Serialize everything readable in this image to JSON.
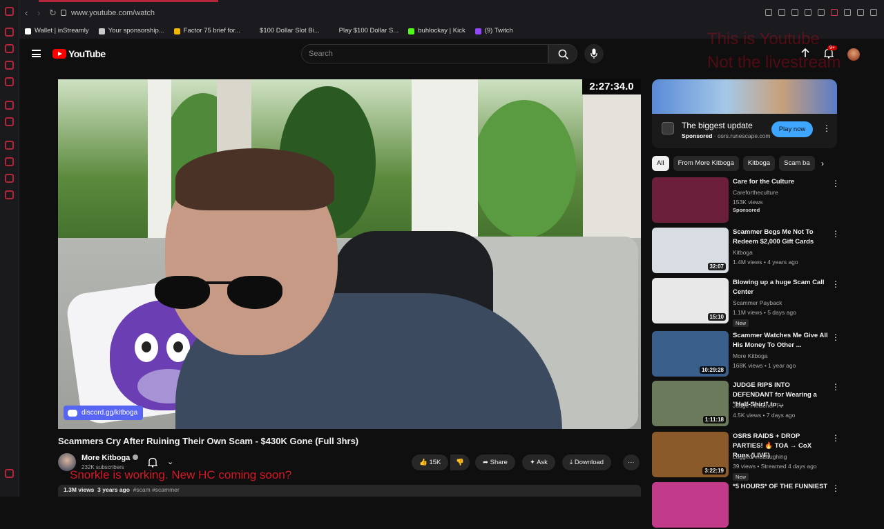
{
  "browser": {
    "url": "www.youtube.com/watch",
    "bookmarks": [
      {
        "label": "Wallet | inStreamly",
        "color": "#ffffff"
      },
      {
        "label": "Your sponsorship...",
        "color": "#cccccc"
      },
      {
        "label": "Factor 75 brief for...",
        "color": "#f4b400"
      },
      {
        "label": "$100 Dollar Slot Bi...",
        "color": "#1b1b1f"
      },
      {
        "label": "Play $100 Dollar S...",
        "color": "#1b1b1f"
      },
      {
        "label": "buhlockay | Kick",
        "color": "#53fc18"
      },
      {
        "label": "(9) Twitch",
        "color": "#9146ff"
      }
    ]
  },
  "header": {
    "logo_text": "YouTube",
    "search_placeholder": "Search",
    "notification_count": "9+",
    "overlay_note": [
      "This is Youtube",
      "Not the livestream"
    ]
  },
  "player": {
    "timer": "2:27:34.0",
    "discord": "discord.gg/kitboga"
  },
  "ad": {
    "title": "The biggest update",
    "sponsored": "Sponsored",
    "domain": "osrs.runescape.com",
    "cta": "Play now"
  },
  "chips": [
    "All",
    "From More Kitboga",
    "Kitboga",
    "Scam ba"
  ],
  "recommendations": [
    {
      "title": "Care for the Culture",
      "channel": "Carefortheculture",
      "stats": "153K views",
      "extra": "Sponsored",
      "duration": "",
      "new": "",
      "thumb": "#6b1f3a"
    },
    {
      "title": "Scammer Begs Me Not To Redeem $2,000 Gift Cards",
      "channel": "Kitboga",
      "stats": "1.4M views • 4 years ago",
      "extra": "",
      "duration": "32:07",
      "new": "",
      "thumb": "#d8dde4"
    },
    {
      "title": "Blowing up a huge Scam Call Center",
      "channel": "Scammer Payback",
      "stats": "1.1M views • 5 days ago",
      "extra": "",
      "duration": "15:10",
      "new": "New",
      "thumb": "#e8e8e8"
    },
    {
      "title": "Scammer Watches Me Give All His Money To Other ...",
      "channel": "More Kitboga",
      "stats": "168K views • 1 year ago",
      "extra": "",
      "duration": "10:29:28",
      "new": "",
      "thumb": "#3a5f8a"
    },
    {
      "title": "JUDGE RIPS INTO DEFENDANT for Wearing a \"Half-Shirt\" to ...",
      "channel": "Judge Fleischer TV",
      "stats": "4.5K views • 7 days ago",
      "extra": "",
      "duration": "1:11:18",
      "new": "",
      "thumb": "#6a7a5a"
    },
    {
      "title": "OSRS RAIDS + DROP PARTIES! 🔥 TOA → CoX Runs (LIVE)",
      "channel": "LaggedAndLaughing",
      "stats": "39 views • Streamed 4 days ago",
      "extra": "",
      "duration": "3:22:19",
      "new": "New",
      "thumb": "#8a5a2a"
    },
    {
      "title": "*5 HOURS* OF THE FUNNIEST",
      "channel": "",
      "stats": "",
      "extra": "",
      "duration": "",
      "new": "",
      "thumb": "#c23a8a"
    }
  ],
  "video": {
    "title": "Scammers Cry After Ruining Their Own Scam - $430K Gone (Full 3hrs)",
    "channel": "More Kitboga",
    "subscribers": "232K subscribers",
    "likes": "15K",
    "share": "Share",
    "ask": "Ask",
    "download": "Download",
    "overlay_message": "Snorkle is working. New HC coming soon?",
    "views": "1.3M views",
    "age": "3 years ago",
    "tags": "#scam #scammer"
  }
}
